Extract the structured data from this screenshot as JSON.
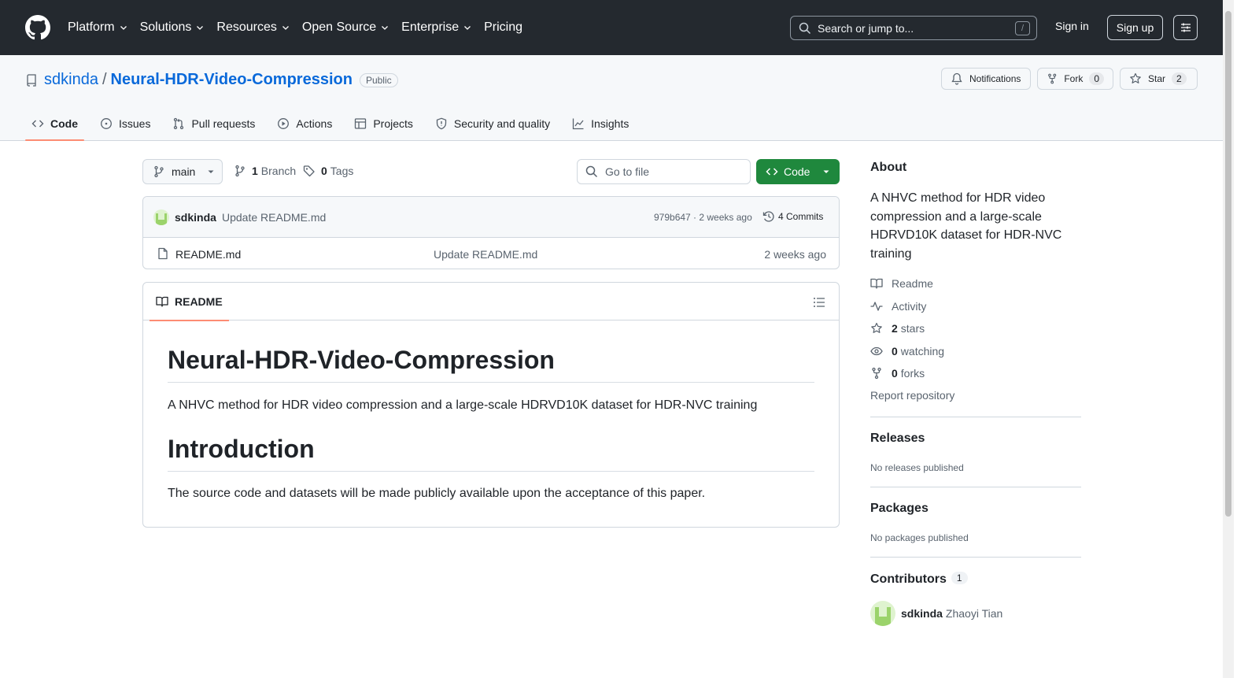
{
  "header": {
    "nav": [
      "Platform",
      "Solutions",
      "Resources",
      "Open Source",
      "Enterprise",
      "Pricing"
    ],
    "search_placeholder": "Search or jump to...",
    "search_shortcut": "/",
    "sign_in": "Sign in",
    "sign_up": "Sign up"
  },
  "repo": {
    "owner": "sdkinda",
    "separator": "/",
    "name": "Neural-HDR-Video-Compression",
    "visibility": "Public",
    "notifications_label": "Notifications",
    "fork_label": "Fork",
    "fork_count": "0",
    "star_label": "Star",
    "star_count": "2"
  },
  "tabs": [
    {
      "label": "Code",
      "active": true
    },
    {
      "label": "Issues"
    },
    {
      "label": "Pull requests"
    },
    {
      "label": "Actions"
    },
    {
      "label": "Projects"
    },
    {
      "label": "Security and quality"
    },
    {
      "label": "Insights"
    }
  ],
  "toolbar": {
    "branch": "main",
    "branch_count": "1",
    "branch_label": "Branch",
    "tag_count": "0",
    "tag_label": "Tags",
    "goto_placeholder": "Go to file",
    "code_label": "Code"
  },
  "commit": {
    "author": "sdkinda",
    "message": "Update README.md",
    "sha_time": "979b647 · 2 weeks ago",
    "commits_label": "4 Commits"
  },
  "files": [
    {
      "name": "README.md",
      "message": "Update README.md",
      "date": "2 weeks ago"
    }
  ],
  "readme": {
    "tab_label": "README",
    "title": "Neural-HDR-Video-Compression",
    "description": "A NHVC method for HDR video compression and a large-scale HDRVD10K dataset for HDR-NVC training",
    "section_title": "Introduction",
    "section_text": "The source code and datasets will be made publicly available upon the acceptance of this paper."
  },
  "sidebar": {
    "about_title": "About",
    "about_text": "A NHVC method for HDR video compression and a large-scale HDRVD10K dataset for HDR-NVC training",
    "readme_link": "Readme",
    "activity_link": "Activity",
    "stars_count": "2",
    "stars_label": "stars",
    "watching_count": "0",
    "watching_label": "watching",
    "forks_count": "0",
    "forks_label": "forks",
    "report": "Report repository",
    "releases_title": "Releases",
    "releases_text": "No releases published",
    "packages_title": "Packages",
    "packages_text": "No packages published",
    "contributors_title": "Contributors",
    "contributors_count": "1",
    "contributor_login": "sdkinda",
    "contributor_name": "Zhaoyi Tian"
  },
  "colors": {
    "header_bg": "#24292f",
    "link": "#0969da",
    "code_button": "#1f883d",
    "active_tab_underline": "#fd8c73"
  }
}
